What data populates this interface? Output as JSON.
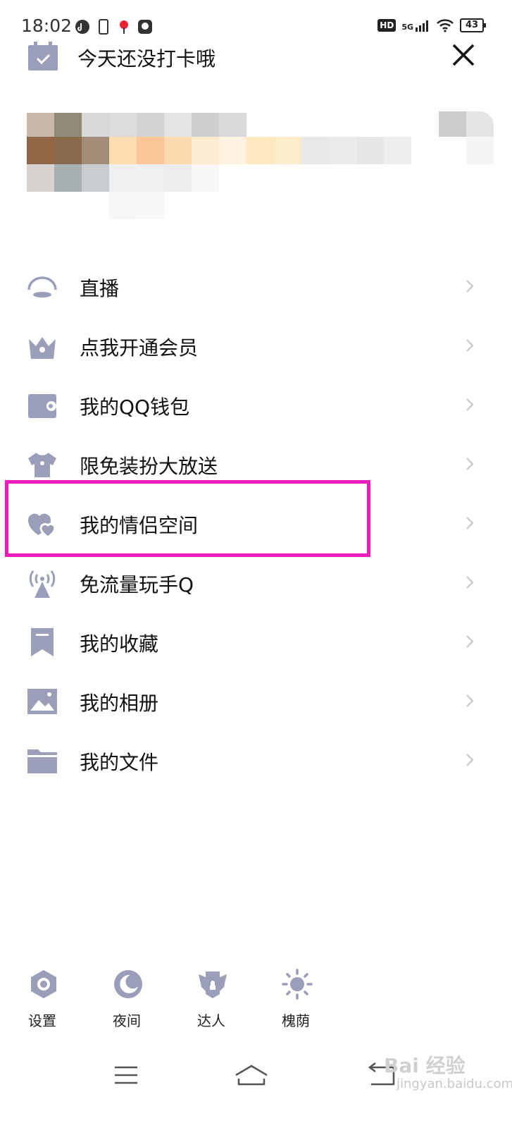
{
  "status_bar": {
    "time": "18:02",
    "hd_label": "HD",
    "network_label": "5G",
    "battery_level": "43"
  },
  "header": {
    "checkin_text": "今天还没打卡哦"
  },
  "menu": {
    "items": [
      {
        "label": "直播",
        "icon": "live-icon"
      },
      {
        "label": "点我开通会员",
        "icon": "vip-crown-icon"
      },
      {
        "label": "我的QQ钱包",
        "icon": "wallet-icon"
      },
      {
        "label": "限免装扮大放送",
        "icon": "tshirt-icon"
      },
      {
        "label": "我的情侣空间",
        "icon": "hearts-icon"
      },
      {
        "label": "免流量玩手Q",
        "icon": "broadcast-tower-icon"
      },
      {
        "label": "我的收藏",
        "icon": "bookmark-icon"
      },
      {
        "label": "我的相册",
        "icon": "photo-icon"
      },
      {
        "label": "我的文件",
        "icon": "folder-icon"
      }
    ],
    "highlighted_index": 4,
    "highlight_color": "#f01bbd"
  },
  "toolbar": {
    "items": [
      {
        "label": "设置",
        "icon": "settings-hexagon-icon"
      },
      {
        "label": "夜间",
        "icon": "moon-icon"
      },
      {
        "label": "达人",
        "icon": "winged-badge-icon"
      },
      {
        "label": "槐荫",
        "icon": "sun-icon"
      }
    ]
  },
  "watermark": {
    "main": "Bai 经验",
    "sub": "jingyan.baidu.com"
  },
  "colors": {
    "icon": "#9a9eb8",
    "chevron": "#c4c4c4"
  }
}
